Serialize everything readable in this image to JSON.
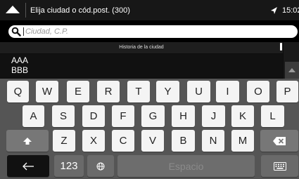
{
  "header": {
    "title": "Elija ciudad o cód.post. (300)",
    "time": "15:02"
  },
  "search": {
    "placeholder": "Ciudad, C.P."
  },
  "history": {
    "header": "Historia de la ciudad",
    "items": [
      "AAA",
      "BBB"
    ]
  },
  "keyboard": {
    "row1": [
      "Q",
      "W",
      "E",
      "R",
      "T",
      "Y",
      "U",
      "I",
      "O",
      "P"
    ],
    "row2": [
      "A",
      "S",
      "D",
      "F",
      "G",
      "H",
      "J",
      "K",
      "L"
    ],
    "row3": [
      "Z",
      "X",
      "C",
      "V",
      "B",
      "N",
      "M"
    ],
    "numbers_label": "123",
    "space_label": "Espacio",
    "icons": [
      "back-arrow-icon",
      "gps-icon",
      "search-icon",
      "shift-icon",
      "backspace-icon",
      "enter-arrow-icon",
      "globe-icon",
      "keyboard-hide-icon"
    ]
  },
  "colors": {
    "topbar": "#171717",
    "keyboard_bg": "#555555",
    "key": "#f4f4f4",
    "key_dark": "#777777"
  }
}
